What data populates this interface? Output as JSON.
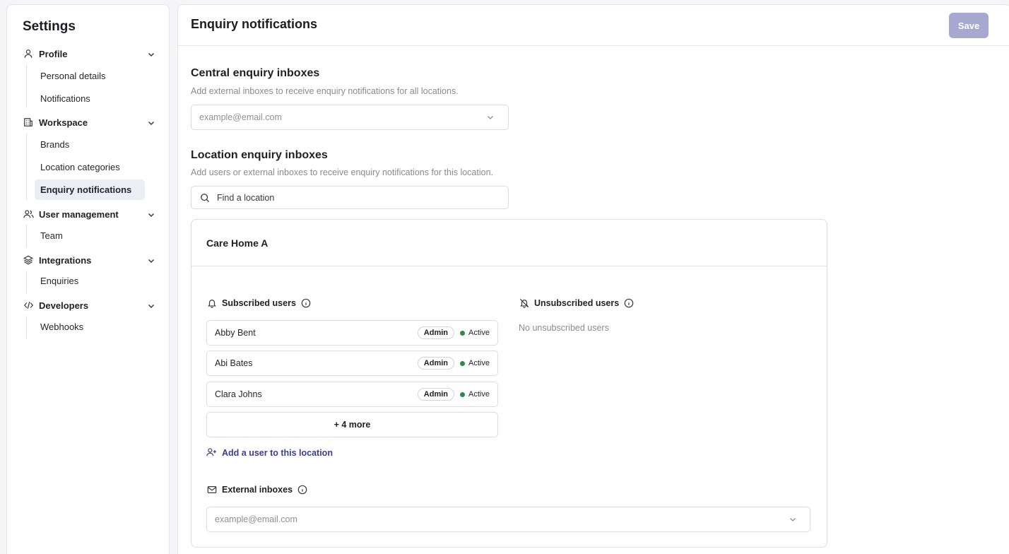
{
  "sidebar": {
    "title": "Settings",
    "groups": [
      {
        "label": "Profile",
        "icon": "user-icon",
        "items": [
          "Personal details",
          "Notifications"
        ]
      },
      {
        "label": "Workspace",
        "icon": "building-icon",
        "items": [
          "Brands",
          "Location categories",
          "Enquiry notifications"
        ]
      },
      {
        "label": "User management",
        "icon": "users-icon",
        "items": [
          "Team"
        ]
      },
      {
        "label": "Integrations",
        "icon": "layers-icon",
        "items": [
          "Enquiries"
        ]
      },
      {
        "label": "Developers",
        "icon": "code-icon",
        "items": [
          "Webhooks"
        ]
      }
    ],
    "active_item": "Enquiry notifications"
  },
  "header": {
    "title": "Enquiry notifications",
    "save_label": "Save"
  },
  "central": {
    "title": "Central enquiry inboxes",
    "description": "Add external inboxes to receive enquiry notifications for all locations.",
    "placeholder": "example@email.com"
  },
  "location": {
    "title": "Location enquiry inboxes",
    "description": "Add users or external inboxes to receive enquiry notifications for this location.",
    "search_placeholder": "Find a location"
  },
  "card": {
    "title": "Care Home A",
    "subscribed_title": "Subscribed users",
    "unsubscribed_title": "Unsubscribed users",
    "unsubscribed_empty": "No unsubscribed users",
    "users": [
      {
        "name": "Abby Bent",
        "role": "Admin",
        "status": "Active"
      },
      {
        "name": "Abi Bates",
        "role": "Admin",
        "status": "Active"
      },
      {
        "name": "Clara Johns",
        "role": "Admin",
        "status": "Active"
      }
    ],
    "more_label": "+ 4 more",
    "add_user_label": "Add a user to this location",
    "external_title": "External inboxes",
    "external_placeholder": "example@email.com"
  },
  "colors": {
    "accent": "#3b3d8f",
    "save_button": "#a7a8cf",
    "active_status": "#2f8a4a"
  }
}
